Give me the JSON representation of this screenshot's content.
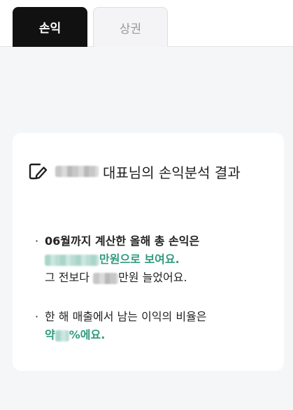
{
  "tabs": {
    "active_label": "손익",
    "inactive_label": "상권"
  },
  "card": {
    "title_suffix": "대표님의 손익분석 결과",
    "line1": "06월까지 계산한 올해 총 손익은",
    "line2_suffix": "만원으로 보여요.",
    "line3_prefix": "그 전보다",
    "line3_suffix": "만원 늘었어요.",
    "line4": "한 해 매출에서 남는 이익의 비율은",
    "line5_prefix": "약",
    "line5_suffix": "%에요."
  },
  "colors": {
    "accent_green": "#2e9a7f",
    "tab_active_bg": "#111111"
  },
  "icons": {
    "card_icon": "edit-document-icon"
  }
}
